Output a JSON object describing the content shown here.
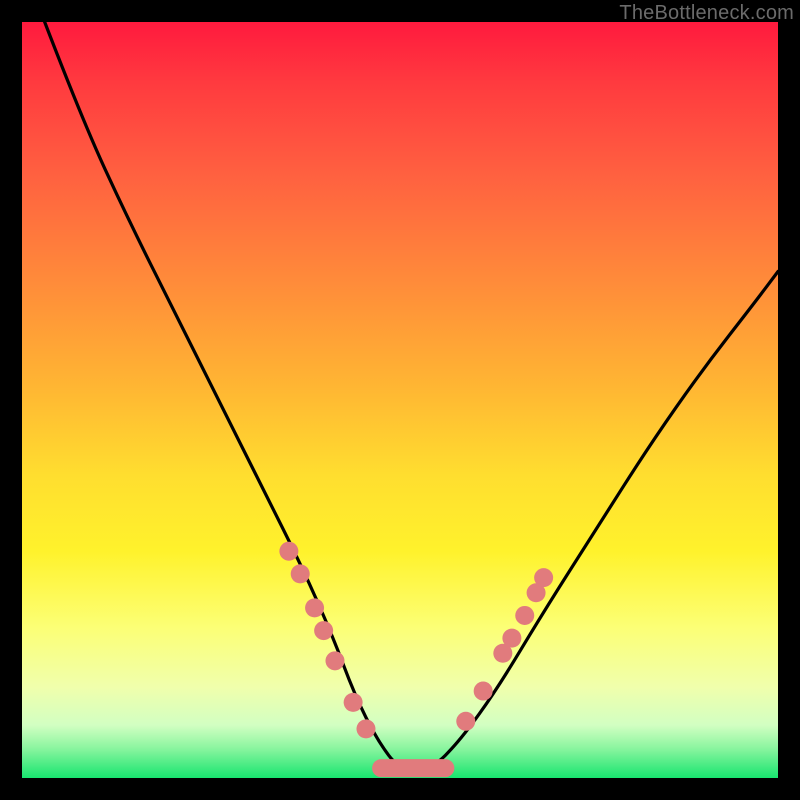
{
  "watermark": "TheBottleneck.com",
  "colors": {
    "bead": "#e17b7d",
    "curve": "#000000"
  },
  "chart_data": {
    "type": "line",
    "title": "",
    "xlabel": "",
    "ylabel": "",
    "xlim": [
      0,
      100
    ],
    "ylim": [
      0,
      100
    ],
    "grid": false,
    "legend": false,
    "note": "Chart has no visible axis ticks or labels; values are estimated on a 0–100 normalized scale from pixel positions.",
    "series": [
      {
        "name": "curve",
        "x": [
          3,
          8,
          14,
          20,
          26,
          32,
          37,
          41,
          44,
          47,
          50,
          54,
          58,
          63,
          69,
          76,
          83,
          90,
          97,
          100
        ],
        "y": [
          100,
          87,
          74,
          62,
          50,
          38,
          28,
          19,
          11,
          5,
          1,
          1,
          5,
          12,
          22,
          33,
          44,
          54,
          63,
          67
        ]
      }
    ],
    "beads_left": [
      {
        "x": 35.3,
        "y": 30.0
      },
      {
        "x": 36.8,
        "y": 27.0
      },
      {
        "x": 38.7,
        "y": 22.5
      },
      {
        "x": 39.9,
        "y": 19.5
      },
      {
        "x": 41.4,
        "y": 15.5
      },
      {
        "x": 43.8,
        "y": 10.0
      },
      {
        "x": 45.5,
        "y": 6.5
      }
    ],
    "beads_right": [
      {
        "x": 58.7,
        "y": 7.5
      },
      {
        "x": 61.0,
        "y": 11.5
      },
      {
        "x": 63.6,
        "y": 16.5
      },
      {
        "x": 64.8,
        "y": 18.5
      },
      {
        "x": 66.5,
        "y": 21.5
      },
      {
        "x": 68.0,
        "y": 24.5
      },
      {
        "x": 69.0,
        "y": 26.5
      }
    ],
    "trough_segment": {
      "x1": 47.5,
      "x2": 56.0,
      "y": 1.3
    }
  }
}
